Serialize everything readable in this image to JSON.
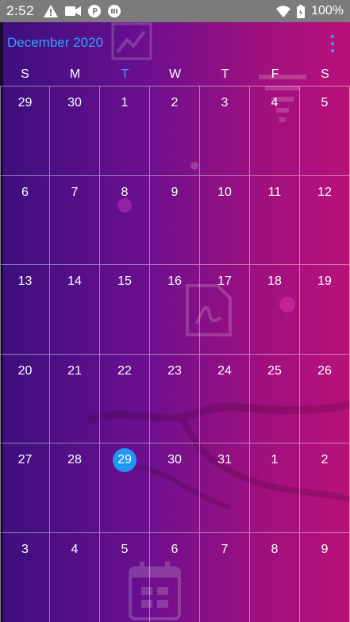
{
  "status_bar": {
    "time": "2:52",
    "battery": "100%",
    "left_icons": [
      "warning-icon",
      "video-icon",
      "parking-icon",
      "app-icon"
    ],
    "right_icons": [
      "wifi-icon",
      "battery-icon"
    ]
  },
  "header": {
    "month_title": "December 2020",
    "menu_icon": "more-vert-icon",
    "accent_color": "#2ea3ff"
  },
  "weekdays": [
    "S",
    "M",
    "T",
    "W",
    "T",
    "F",
    "S"
  ],
  "today_weekday_index": 2,
  "weeks": [
    [
      "29",
      "30",
      "1",
      "2",
      "3",
      "4",
      "5"
    ],
    [
      "6",
      "7",
      "8",
      "9",
      "10",
      "11",
      "12"
    ],
    [
      "13",
      "14",
      "15",
      "16",
      "17",
      "18",
      "19"
    ],
    [
      "20",
      "21",
      "22",
      "23",
      "24",
      "25",
      "26"
    ],
    [
      "27",
      "28",
      "29",
      "30",
      "31",
      "1",
      "2"
    ],
    [
      "3",
      "4",
      "5",
      "6",
      "7",
      "8",
      "9"
    ]
  ],
  "today": {
    "week": 4,
    "day": 2,
    "highlight_color": "#2196f3"
  }
}
